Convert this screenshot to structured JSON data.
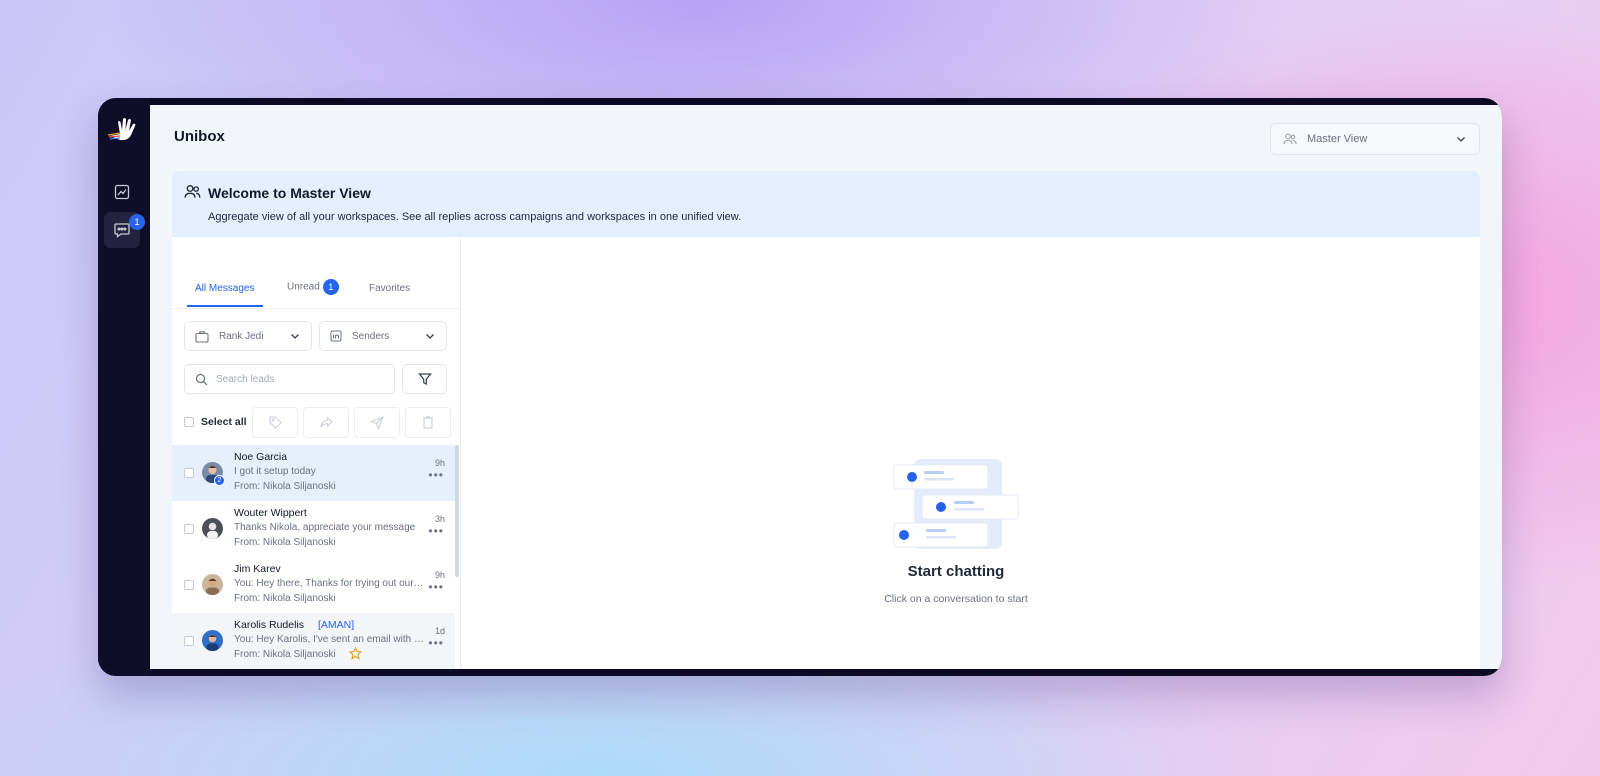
{
  "app": {
    "title": "Unibox"
  },
  "sidebar": {
    "logo": "hand-logo-icon",
    "items": [
      {
        "name": "analytics",
        "icon": "chart-icon"
      },
      {
        "name": "unibox",
        "icon": "chat-bubble-icon",
        "badge": "1",
        "active": true
      }
    ]
  },
  "header": {
    "view_select": {
      "label": "Master View",
      "icon": "users-icon"
    }
  },
  "banner": {
    "title": "Welcome to Master View",
    "description": "Aggregate view of all your workspaces. See all replies across campaigns and workspaces in one unified view."
  },
  "tabs": [
    {
      "label": "All Messages",
      "active": true
    },
    {
      "label": "Unread",
      "badge": "1"
    },
    {
      "label": "Favorites"
    }
  ],
  "filters": {
    "workspace": "Rank Jedi",
    "senders": "Senders",
    "search_placeholder": "Search leads",
    "select_all": "Select all"
  },
  "conversations": [
    {
      "name": "Noe Garcia",
      "preview": "I got it setup today",
      "from": "From: Nikola Siljanoski",
      "time": "9h",
      "badge": "2",
      "selected": true
    },
    {
      "name": "Wouter Wippert",
      "preview": "Thanks Nikola, appreciate your message",
      "from": "From: Nikola Siljanoski",
      "time": "3h"
    },
    {
      "name": "Jim Karev",
      "preview": "You: Hey there, Thanks for trying out our product",
      "from": "From: Nikola Siljanoski",
      "time": "9h"
    },
    {
      "name": "Karolis Rudelis",
      "tag": "[AMAN]",
      "preview": "You: Hey Karolis, I've sent an email with details",
      "from": "From: Nikola Siljanoski",
      "time": "1d",
      "starred": true
    }
  ],
  "empty_state": {
    "title": "Start chatting",
    "subtitle": "Click on a conversation to start"
  },
  "colors": {
    "accent": "#2563eb",
    "sidebar": "#0f0d28",
    "banner": "#e3effd",
    "selected_row": "#e6effc"
  }
}
